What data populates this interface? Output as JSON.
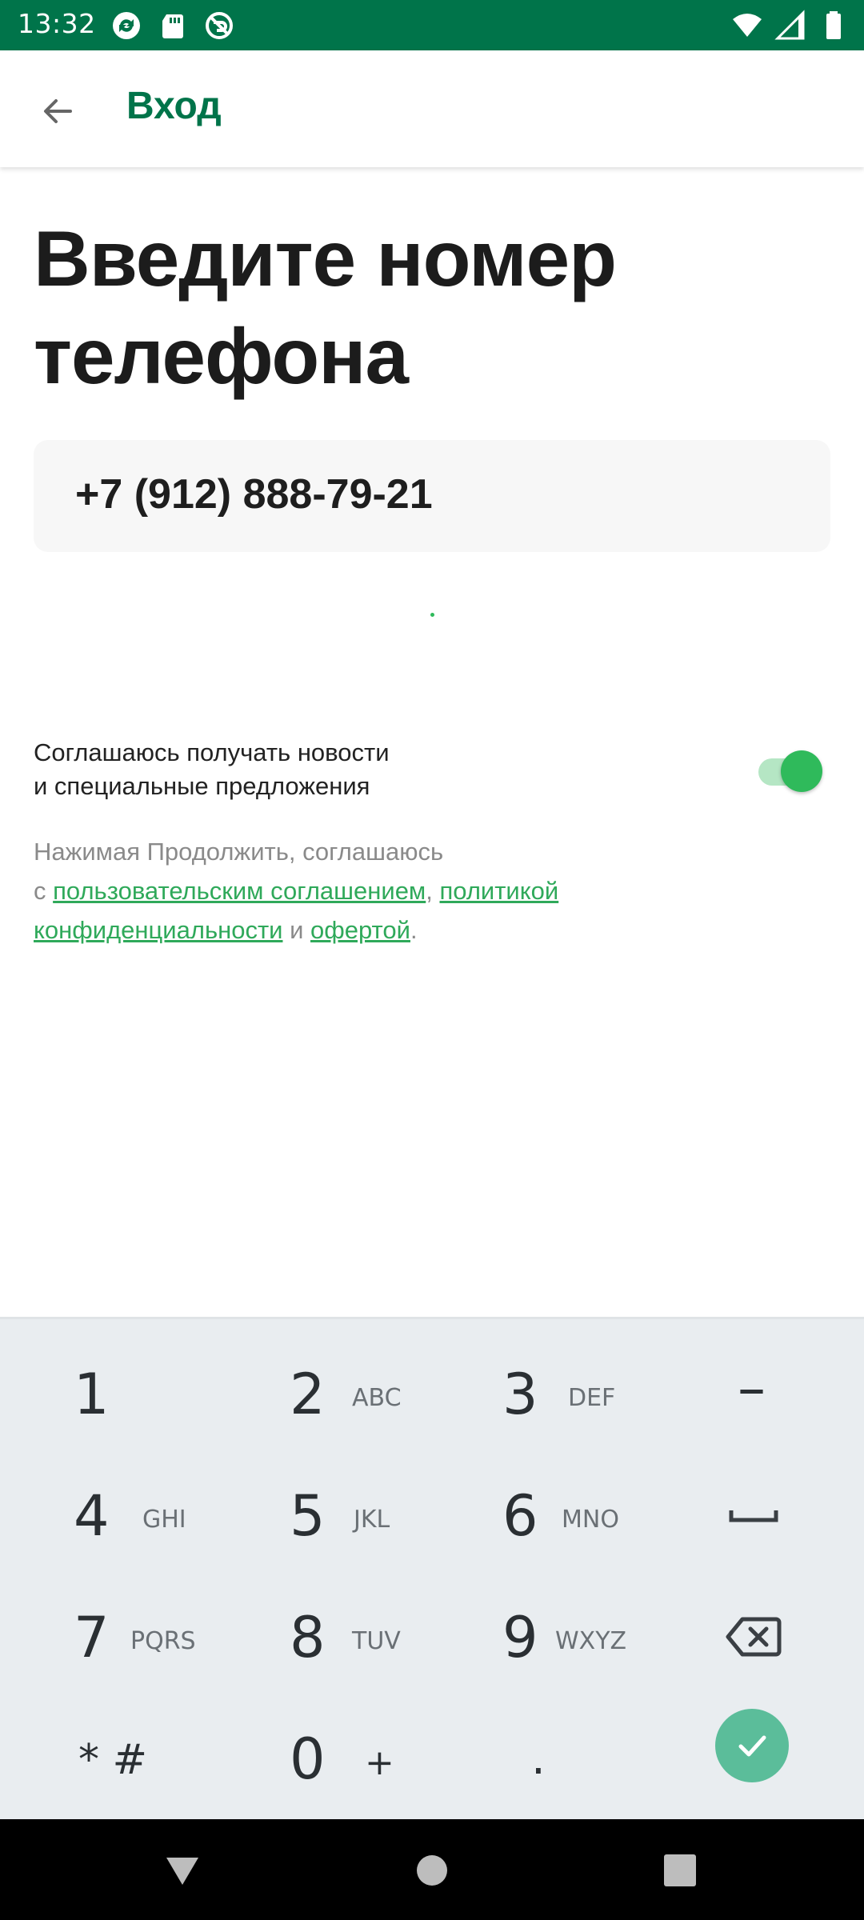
{
  "status_bar": {
    "time": "13:32",
    "icons_left": [
      "sync-icon",
      "sd-card-icon",
      "do-not-disturb-icon"
    ],
    "icons_right": [
      "wifi-icon",
      "signal-icon",
      "battery-icon"
    ]
  },
  "app_bar": {
    "back_icon": "arrow-back-icon",
    "title": "Вход"
  },
  "main": {
    "title": "Введите номер телефона",
    "phone_value": "+7 (912) 888-79-21",
    "consent_line1": "Соглашаюсь получать новости",
    "consent_line2": "и специальные предложения",
    "consent_toggle_on": true,
    "legal": {
      "prefix": "Нажимая Продолжить, соглашаюсь",
      "c": "с ",
      "user_agreement": "пользовательским соглашением",
      "comma": ", ",
      "policy_1": "политикой",
      "policy_2": "конфиденциальности",
      "and": " и ",
      "offer": "офертой",
      "period": "."
    }
  },
  "keyboard": {
    "keys": [
      {
        "num": "1",
        "letters": ""
      },
      {
        "num": "2",
        "letters": "ABC"
      },
      {
        "num": "3",
        "letters": "DEF"
      },
      {
        "num": "–",
        "letters": ""
      },
      {
        "num": "4",
        "letters": "GHI"
      },
      {
        "num": "5",
        "letters": "JKL"
      },
      {
        "num": "6",
        "letters": "MNO"
      },
      {
        "num": "␣",
        "letters": ""
      },
      {
        "num": "7",
        "letters": "PQRS"
      },
      {
        "num": "8",
        "letters": "TUV"
      },
      {
        "num": "9",
        "letters": "WXYZ"
      },
      {
        "num": "",
        "letters": ""
      },
      {
        "num": "* #",
        "letters": ""
      },
      {
        "num": "0",
        "letters": "+"
      },
      {
        "num": ".",
        "letters": ""
      }
    ],
    "backspace_icon": "backspace-icon",
    "enter_icon": "check-icon",
    "accent": "#5bbd9a"
  },
  "nav_bar": {
    "back_icon": "nav-back-triangle-icon",
    "home_icon": "nav-home-circle-icon",
    "recents_icon": "nav-recents-square-icon"
  },
  "colors": {
    "brand_green": "#00744a",
    "link_green": "#2fa95a",
    "toggle_green": "#2fba5b"
  }
}
